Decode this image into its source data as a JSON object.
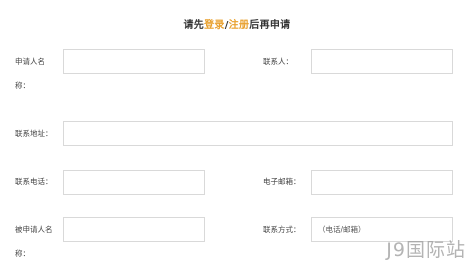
{
  "notice": {
    "before": "请先",
    "login": "登录",
    "slash": "/",
    "register": "注册",
    "after": "后再申请"
  },
  "form": {
    "applicant_label_line1": "申请人名",
    "applicant_label_line2": "称：",
    "contact_label": "联系人：",
    "address_label": "联系地址：",
    "phone_label": "联系电话：",
    "email_label": "电子邮箱：",
    "respondent_label_line1": "被申请人名",
    "respondent_label_line2": "称：",
    "contact_method_label": "联系方式：",
    "contact_method_value": "（电话/邮箱）"
  },
  "watermark": "J9国际站"
}
